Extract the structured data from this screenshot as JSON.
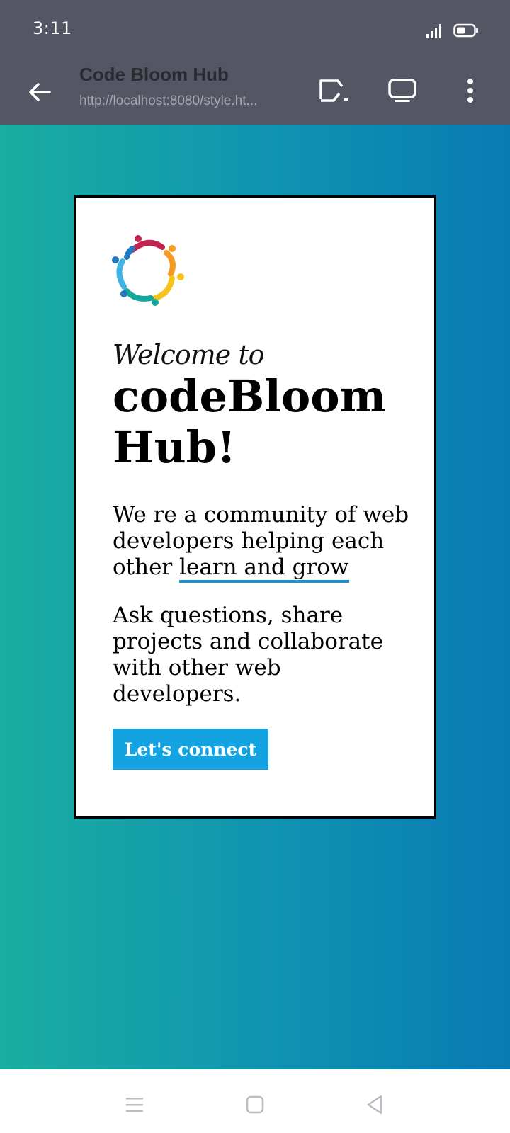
{
  "status_bar": {
    "time": "3:11",
    "icons": [
      "signal-icon",
      "battery-icon"
    ]
  },
  "app_bar": {
    "title": "Code Bloom Hub",
    "url": "http://localhost:8080/style.ht...",
    "icons": [
      "back-arrow-icon",
      "cast-icon",
      "desktop-icon",
      "more-vert-icon"
    ]
  },
  "page": {
    "welcome": "Welcome to",
    "title": "codeBloom Hub!",
    "para1_start": "We re a community of web developers helping each other ",
    "para1_highlight": "learn and grow",
    "para2": "Ask questions, share projects and collaborate with other web developers.",
    "cta_label": "Let's connect",
    "accent_color": "#13a3e1",
    "gradient_colors": [
      "#19aea0",
      "#0a7ab3"
    ],
    "logo_colors": [
      "#c0244f",
      "#f59a23",
      "#f7c31a",
      "#15a99a",
      "#1f7ac2",
      "#3fb3e6"
    ]
  },
  "nav_bar": {
    "icons": [
      "menu-icon",
      "home-square-icon",
      "back-triangle-icon"
    ]
  }
}
